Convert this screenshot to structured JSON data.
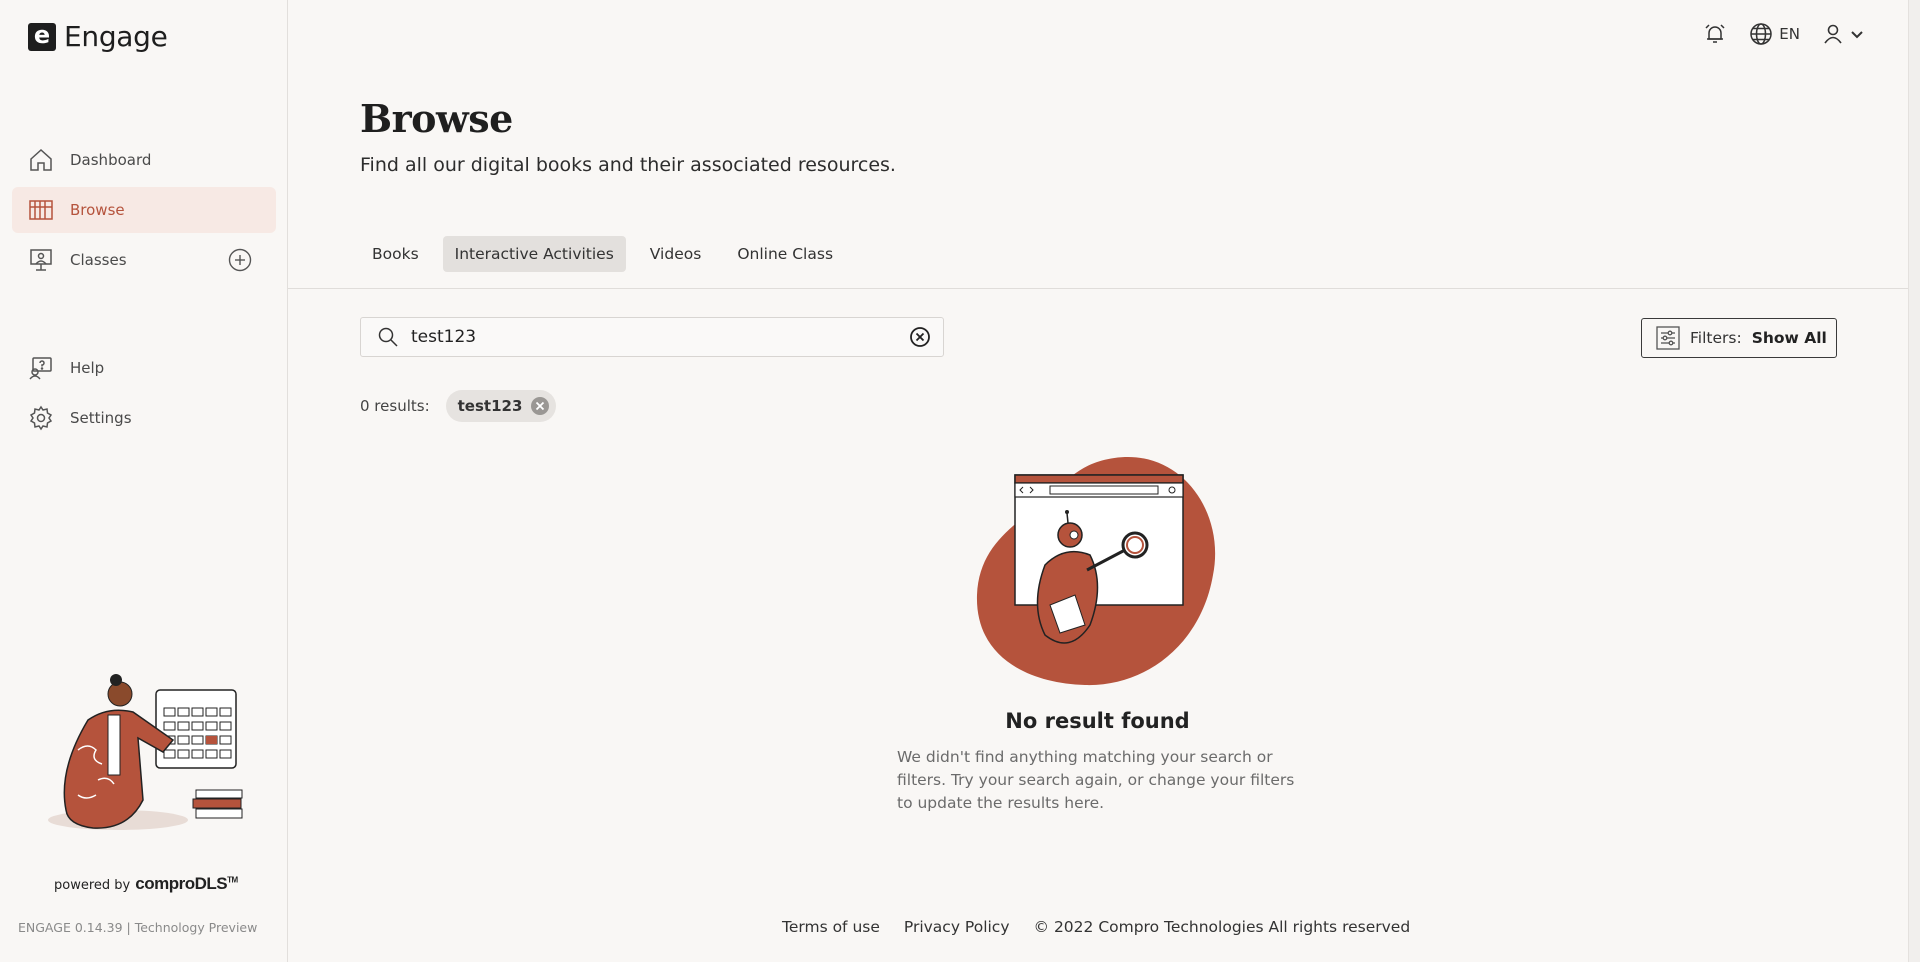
{
  "app": {
    "logo_letter": "e",
    "name": "Engage"
  },
  "sidebar": {
    "items": [
      {
        "label": "Dashboard",
        "icon": "home-icon"
      },
      {
        "label": "Browse",
        "icon": "books-icon",
        "active": true
      },
      {
        "label": "Classes",
        "icon": "classroom-icon"
      },
      {
        "label": "Help",
        "icon": "help-icon"
      },
      {
        "label": "Settings",
        "icon": "gear-icon"
      }
    ],
    "powered_by": "powered by",
    "brand": "comproDLS",
    "brand_tm": "TM",
    "version": "ENGAGE 0.14.39 | Technology Preview"
  },
  "header": {
    "language": "EN"
  },
  "page": {
    "title": "Browse",
    "subtitle": "Find all our digital books and their associated resources."
  },
  "tabs": [
    {
      "label": "Books"
    },
    {
      "label": "Interactive Activities",
      "active": true
    },
    {
      "label": "Videos"
    },
    {
      "label": "Online Class"
    }
  ],
  "search": {
    "value": "test123"
  },
  "filters": {
    "label": "Filters:",
    "value": "Show All"
  },
  "results": {
    "count_label": "0 results:",
    "chip": "test123"
  },
  "empty": {
    "title": "No result found",
    "text": "We didn't find anything matching your search or filters. Try your search again, or change your filters to update the results here."
  },
  "footer": {
    "terms": "Terms of use",
    "privacy": "Privacy Policy",
    "copyright": "© 2022 Compro Technologies All rights reserved"
  },
  "colors": {
    "accent": "#b5533c",
    "active_bg": "#f7e9e4",
    "background": "#f9f7f5"
  }
}
